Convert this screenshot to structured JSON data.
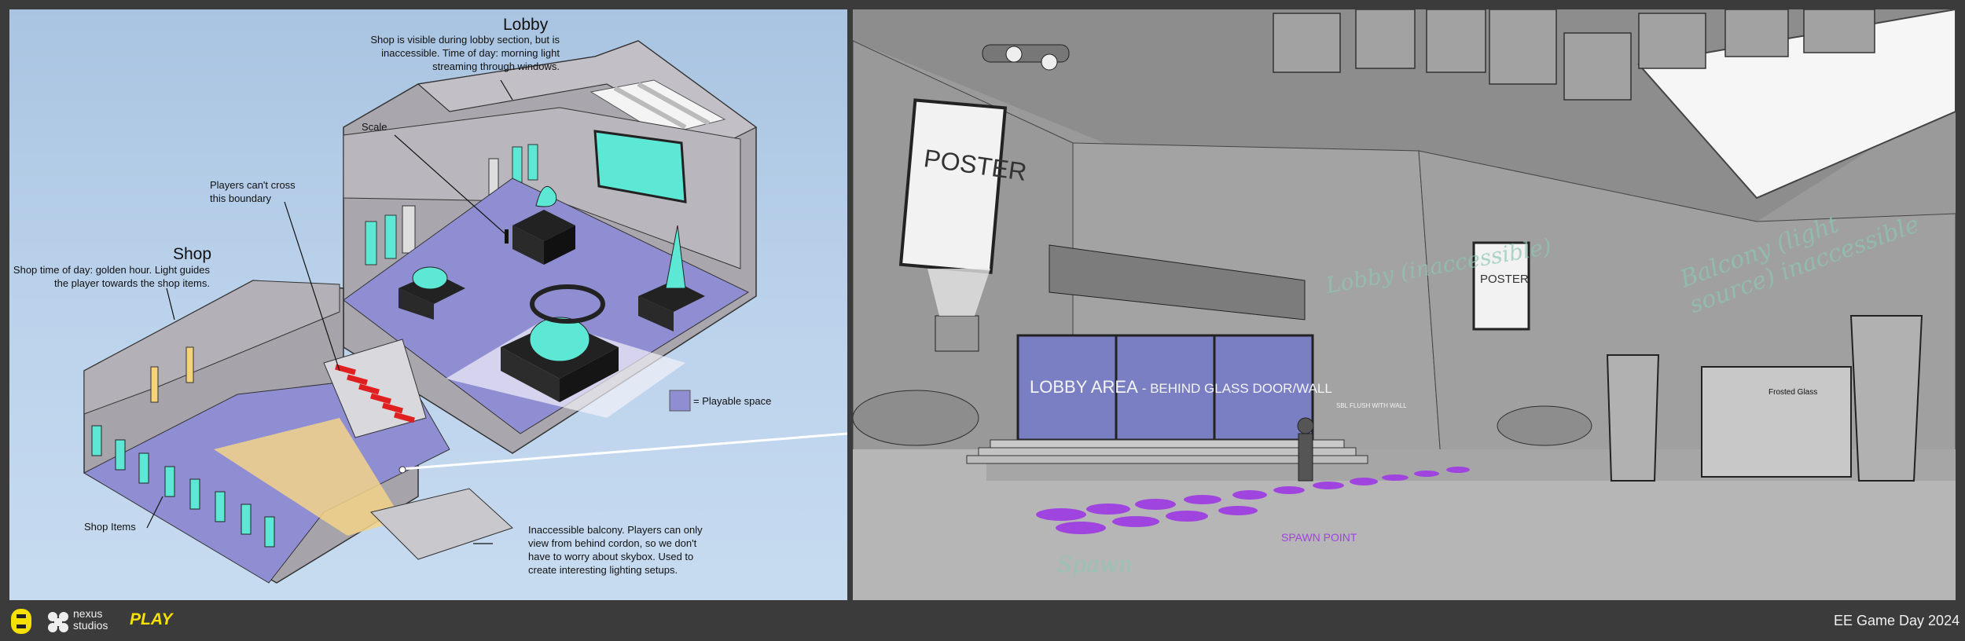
{
  "left": {
    "lobby_title": "Lobby",
    "lobby_note": "Shop is visible during lobby section, but is inaccessible. Time of day: morning light streaming through windows.",
    "scale_label": "Scale",
    "boundary_note": "Players can't cross this boundary",
    "shop_title": "Shop",
    "shop_note": "Shop time of day: golden hour. Light guides the player towards the shop items.",
    "shop_items_label": "Shop Items",
    "playable_legend": "= Playable space",
    "balcony_note": "Inaccessible balcony. Players can only view from behind cordon, so we don't have to worry about skybox. Used to create interesting lighting setups."
  },
  "right": {
    "poster_large": "POSTER",
    "poster_small": "POSTER",
    "lobby_area": "LOBBY AREA",
    "lobby_area_sub": "- BEHIND GLASS DOOR/WALL",
    "flush_note": "SBL FLUSH WITH WALL",
    "frosted_glass": "Frosted Glass",
    "spawn_point": "SPAWN POINT",
    "script_lobby": "Lobby (inaccessible)",
    "script_lighting": "Balcony (light source) inaccessible",
    "script_spawn": "Spawn"
  },
  "footer": {
    "nexus_line1": "nexus",
    "nexus_line2": "studios",
    "play": "PLAY",
    "event": "EE Game Day 2024"
  },
  "colors": {
    "playable": "#8f8ed3",
    "cyan": "#5de8d5",
    "spawn": "#a044e0",
    "ee_yellow": "#f5e000"
  }
}
